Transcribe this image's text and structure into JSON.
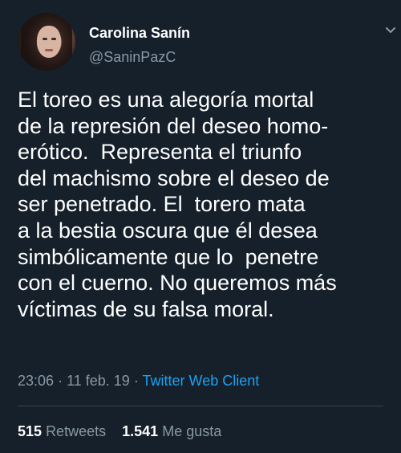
{
  "author": {
    "name": "Carolina Sanín",
    "handle": "@SaninPazC"
  },
  "tweet": {
    "lines": [
      "El toreo es una alegoría mortal",
      "de la represión del deseo homo-",
      "erótico.  Representa el triunfo",
      "del machismo sobre el deseo de",
      "ser penetrado. El  torero mata",
      "a la bestia oscura que él desea",
      "simbólicamente que lo  penetre",
      "con el cuerno. No queremos más",
      "víctimas de su falsa moral."
    ]
  },
  "meta": {
    "time": "23:06",
    "date": "11 feb. 19",
    "separator": "·",
    "client": "Twitter Web Client"
  },
  "stats": {
    "retweets_count": "515",
    "retweets_label": "Retweets",
    "likes_count": "1.541",
    "likes_label": "Me gusta"
  },
  "icons": {
    "caret": "chevron-down-icon",
    "avatar": "avatar"
  },
  "colors": {
    "background": "#15202b",
    "text": "#ffffff",
    "muted": "#8899a6",
    "link": "#1da1f2",
    "divider": "#38444d"
  }
}
